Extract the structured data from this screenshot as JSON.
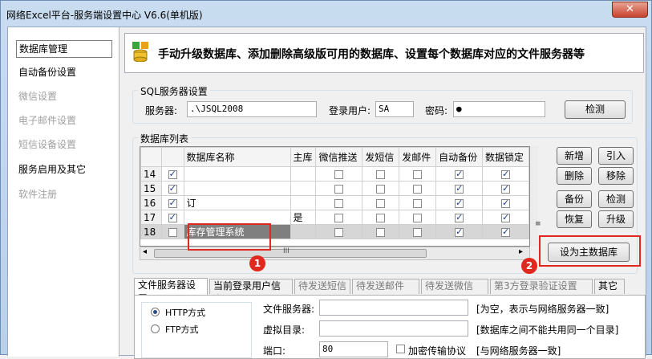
{
  "window": {
    "title": "网络Excel平台-服务端设置中心 V6.6(单机版)",
    "close_glyph": "✕"
  },
  "nav": {
    "items": [
      {
        "label": "数据库管理",
        "state": "active"
      },
      {
        "label": "自动备份设置",
        "state": "normal"
      },
      {
        "label": "微信设置",
        "state": "disabled"
      },
      {
        "label": "电子邮件设置",
        "state": "disabled"
      },
      {
        "label": "短信设备设置",
        "state": "disabled"
      },
      {
        "label": "服务启用及其它",
        "state": "normal"
      },
      {
        "label": "软件注册",
        "state": "disabled"
      }
    ]
  },
  "banner": {
    "text": "手动升级数据库、添加删除高级版可用的数据库、设置每个数据库对应的文件服务器等",
    "icon": "database-icon"
  },
  "sql": {
    "group_title": "SQL服务器设置",
    "server_label": "服务器:",
    "server_value": ".\\JSQL2008",
    "user_label": "登录用户:",
    "user_value": "SA",
    "password_label": "密码:",
    "password_value": "●",
    "check_button": "检测"
  },
  "dblist": {
    "group_title": "数据库列表",
    "columns": [
      "数据库名称",
      "主库",
      "微信推送",
      "发短信",
      "发邮件",
      "自动备份",
      "数据锁定"
    ],
    "rows": [
      {
        "num": "14",
        "checked": true,
        "name": "",
        "main": "",
        "flags": [
          false,
          false,
          false,
          true,
          true
        ]
      },
      {
        "num": "15",
        "checked": true,
        "name": "",
        "main": "",
        "flags": [
          false,
          false,
          false,
          true,
          true
        ]
      },
      {
        "num": "16",
        "checked": true,
        "name": "订",
        "main": "",
        "flags": [
          false,
          false,
          false,
          true,
          true
        ]
      },
      {
        "num": "17",
        "checked": true,
        "name": "",
        "main": "是",
        "flags": [
          false,
          false,
          false,
          true,
          true
        ]
      },
      {
        "num": "18",
        "checked": false,
        "name": "库存管理系统",
        "main": "",
        "flags": [
          false,
          false,
          false,
          true,
          true
        ],
        "selected": true
      }
    ],
    "row18_marker": "▶",
    "scroll_text": "III",
    "buttons": {
      "add": "新增",
      "import": "引入",
      "delete": "删除",
      "remove": "移除",
      "backup": "备份",
      "check": "检测",
      "restore": "恢复",
      "upgrade": "升级",
      "set_main": "设为主数据库"
    }
  },
  "annotations": {
    "one": "1",
    "two": "2"
  },
  "tabs": [
    {
      "label": "文件服务器设置",
      "state": "active"
    },
    {
      "label": "当前登录用户信息",
      "state": "normal"
    },
    {
      "label": "待发送短信",
      "state": "inactive"
    },
    {
      "label": "待发送邮件",
      "state": "inactive"
    },
    {
      "label": "待发送微信",
      "state": "inactive"
    },
    {
      "label": "第3方登录验证设置",
      "state": "inactive"
    },
    {
      "label": "其它",
      "state": "normal"
    }
  ],
  "file_server": {
    "http_label": "HTTP方式",
    "ftp_label": "FTP方式",
    "selected": "HTTP",
    "server_label": "文件服务器:",
    "server_value": "",
    "server_hint": "[为空，表示与网络服务器一致]",
    "vdir_label": "虚拟目录:",
    "vdir_value": "",
    "vdir_hint": "[数据库之间不能共用同一个目录]",
    "port_label": "端口:",
    "port_value": "80",
    "encrypt_label": "加密传输协议",
    "encrypt_hint": "[与网络服务器一致]"
  }
}
